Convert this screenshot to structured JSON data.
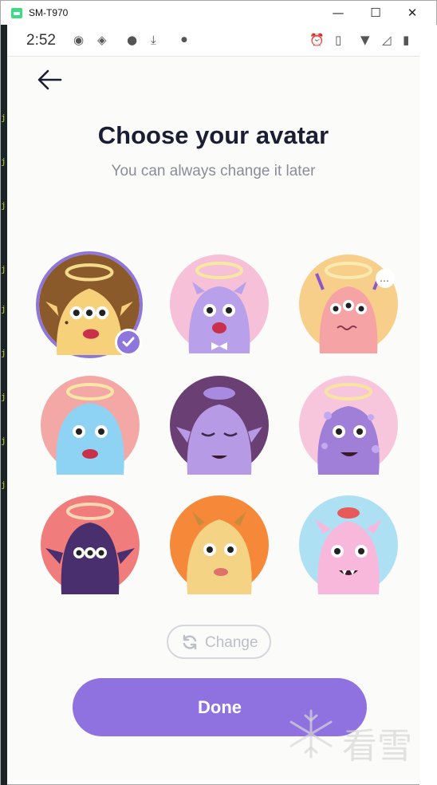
{
  "window": {
    "title": "SM-T970",
    "minimize": "—",
    "maximize": "☐",
    "close": "✕"
  },
  "status_bar": {
    "time": "2:52"
  },
  "page": {
    "title": "Choose your avatar",
    "subtitle": "You can always change it later",
    "selected_avatar": 1
  },
  "change_button": {
    "label": "Change"
  },
  "done_button": {
    "label": "Done"
  },
  "watermark": {
    "text": "看雪"
  },
  "colors": {
    "accent": "#8f72e0",
    "title": "#1b1d33",
    "subtitle": "#8a8c98"
  },
  "avatars": [
    {
      "id": 1,
      "icon": "horned-yellow-monster",
      "bg": "#8a5a2b",
      "body": "#f7d07a"
    },
    {
      "id": 2,
      "icon": "purple-bowtie-monster",
      "bg": "#f6c0d8",
      "body": "#b9a0ea"
    },
    {
      "id": 3,
      "icon": "pink-antenna-monster",
      "bg": "#f7cf8a",
      "body": "#f6a3a6"
    },
    {
      "id": 4,
      "icon": "blue-fluffy-monster",
      "bg": "#f4a8a6",
      "body": "#8fd3f4"
    },
    {
      "id": 5,
      "icon": "lavender-sleepy-monster",
      "bg": "#6a3f73",
      "body": "#b79ae6"
    },
    {
      "id": 6,
      "icon": "spotted-purple-monster",
      "bg": "#f8c6dc",
      "body": "#a07fd8"
    },
    {
      "id": 7,
      "icon": "dark-purple-monster",
      "bg": "#f07c7c",
      "body": "#4a2f6e"
    },
    {
      "id": 8,
      "icon": "orange-furry-monster",
      "bg": "#f6883a",
      "body": "#f5d384"
    },
    {
      "id": 9,
      "icon": "pink-fanged-monster",
      "bg": "#aee0f4",
      "body": "#f7b8dc"
    }
  ]
}
